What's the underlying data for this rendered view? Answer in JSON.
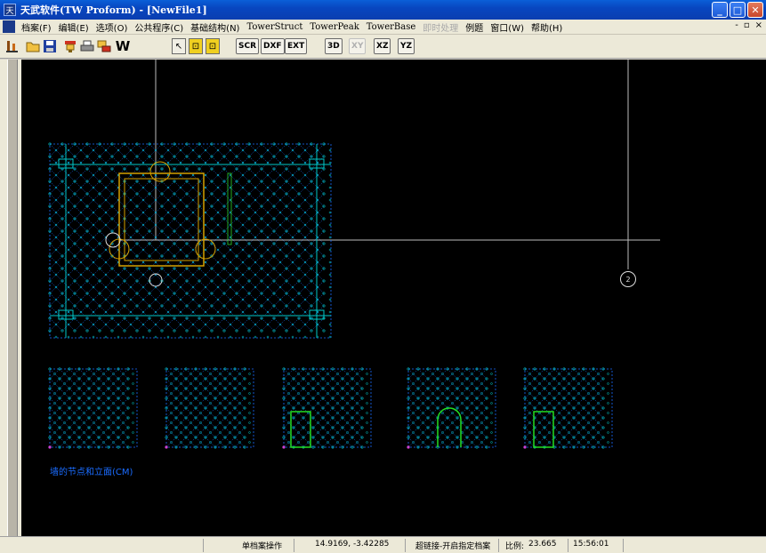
{
  "window": {
    "title": "天武软件(TW Proform) - [NewFile1]",
    "controls": {
      "minimize": "_",
      "maximize": "□",
      "close": "✕"
    }
  },
  "menu": {
    "items": [
      {
        "label": "档案(F)"
      },
      {
        "label": "编辑(E)"
      },
      {
        "label": "选项(O)"
      },
      {
        "label": "公共程序(C)"
      },
      {
        "label": "基础结构(N)"
      },
      {
        "label": "TowerStruct"
      },
      {
        "label": "TowerPeak"
      },
      {
        "label": "TowerBase"
      },
      {
        "label": "即时处理",
        "disabled": true
      },
      {
        "label": "例题"
      },
      {
        "label": "窗口(W)"
      },
      {
        "label": "帮助(H)"
      }
    ],
    "mdi_controls": [
      "-",
      "▫",
      "×"
    ]
  },
  "toolbar": {
    "icons": [
      "open-project-icon",
      "folder-icon",
      "save-icon",
      "preview-icon",
      "print-icon",
      "print-setup-icon",
      "w-icon"
    ],
    "w_label": "W",
    "toggles": [
      "↖",
      "⊡",
      "⊡"
    ],
    "buttons": [
      "SCR",
      "DXF",
      "EXT",
      "3D",
      "XY",
      "XZ",
      "YZ"
    ],
    "disabled_buttons": [
      "XY"
    ]
  },
  "canvas": {
    "caption": "墙的节点和立面(CM)",
    "marker_label": "2",
    "background": "#000000",
    "grid_color": "#1a6cff",
    "node_color": "#00c8c8",
    "frame_color": "#d4a000",
    "opening_color": "#22dd22"
  },
  "status": {
    "mode": "单档案操作",
    "coordinates": "14.9169, -3.42285",
    "hyperlink": "超链接-开启指定档案",
    "scale_label": "比例:",
    "scale_value": "23.665",
    "time": "15:56:01"
  }
}
